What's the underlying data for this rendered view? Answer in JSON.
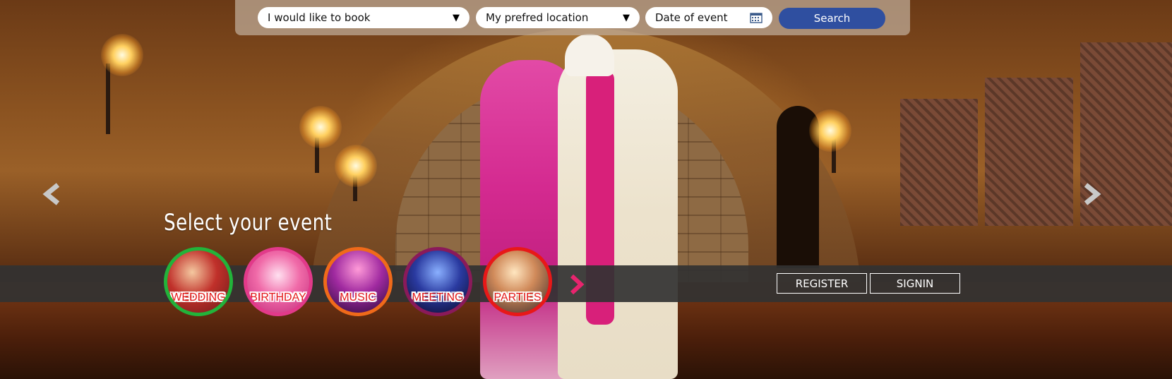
{
  "search": {
    "booking_select": "I would like to book",
    "location_select": "My prefred location",
    "date_placeholder": "Date of event",
    "search_label": "Search"
  },
  "events": {
    "title": "Select your event",
    "items": [
      {
        "label": "WEDDING",
        "ring_color": "#22b33a"
      },
      {
        "label": "BIRTHDAY",
        "ring_color": "#e23a8a"
      },
      {
        "label": "MUSIC",
        "ring_color": "#f06a1a"
      },
      {
        "label": "MEETING",
        "ring_color": "#8a1a5a"
      },
      {
        "label": "PARTIES",
        "ring_color": "#e81818"
      }
    ],
    "more_icon": "chevron-right-icon",
    "more_color": "#e8246e"
  },
  "auth": {
    "register_label": "REGISTER",
    "signin_label": "SIGNIN"
  },
  "slider": {
    "prev_icon": "chevron-left-icon",
    "next_icon": "chevron-right-icon"
  },
  "colors": {
    "search_button": "#2f4fa0",
    "strip": "#323232"
  }
}
